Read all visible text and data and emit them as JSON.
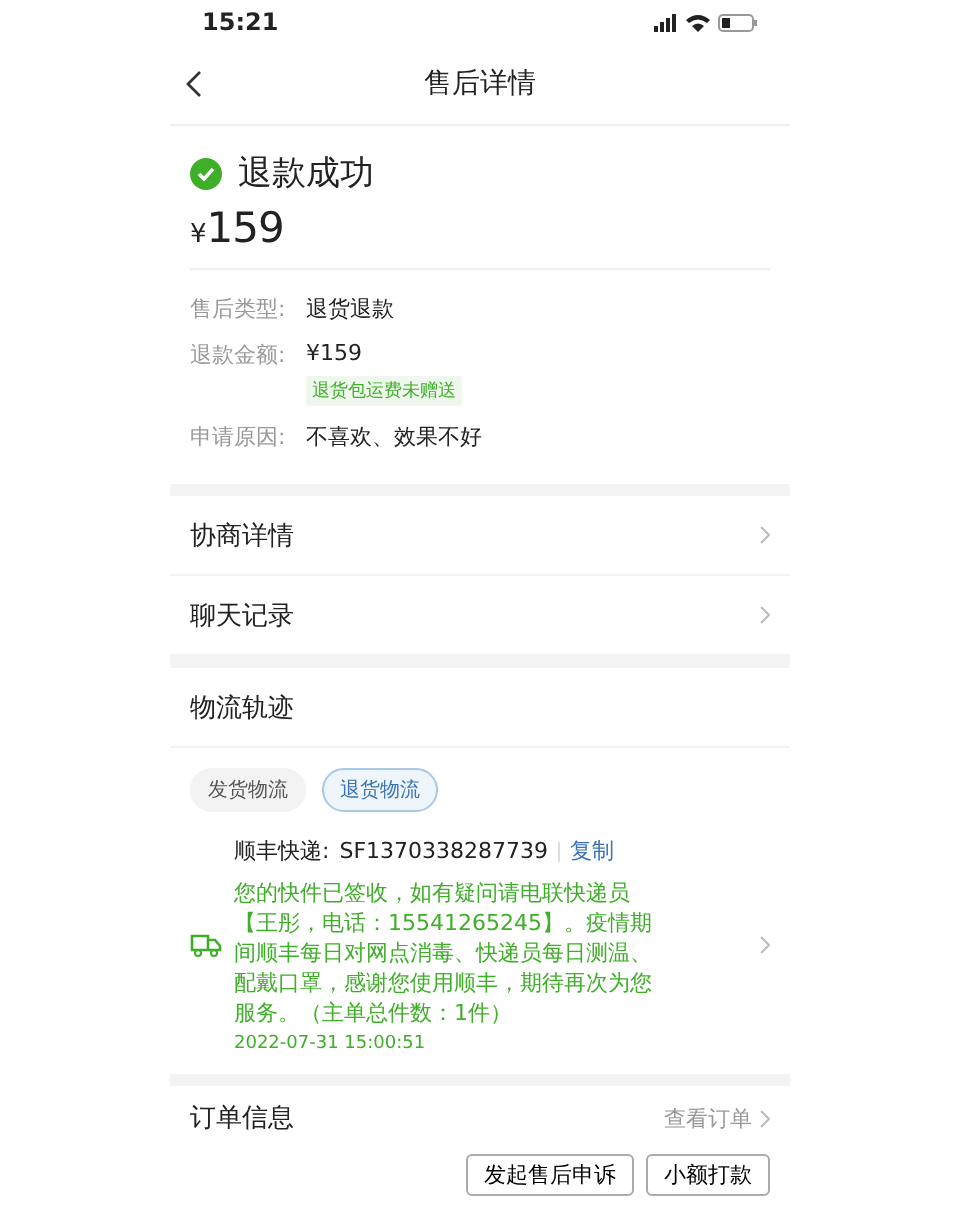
{
  "status_bar": {
    "time": "15:21"
  },
  "nav": {
    "title": "售后详情"
  },
  "refund": {
    "status": "退款成功",
    "currency": "¥",
    "amount": "159",
    "details": [
      {
        "label": "售后类型:",
        "value": "退货退款"
      },
      {
        "label": "退款金额:",
        "value": "¥159",
        "note": "退货包运费未赠送"
      },
      {
        "label": "申请原因:",
        "value": "不喜欢、效果不好"
      }
    ]
  },
  "menu_items": [
    {
      "label": "协商详情"
    },
    {
      "label": "聊天记录"
    }
  ],
  "logistics": {
    "title": "物流轨迹",
    "tabs": [
      {
        "label": "发货物流",
        "selected": false
      },
      {
        "label": "退货物流",
        "selected": true
      }
    ],
    "carrier": "顺丰快递:",
    "tracking_number": "SF1370338287739",
    "copy": "复制",
    "message": "您的快件已签收，如有疑问请电联快递员【王彤，电话：15541265245】。疫情期间顺丰每日对网点消毒、快递员每日测温、配戴口罩，感谢您使用顺丰，期待再次为您服务。（主单总件数：1件）",
    "time": "2022-07-31 15:00:51"
  },
  "order": {
    "title": "订单信息",
    "link": "查看订单"
  },
  "buttons": [
    "发起售后申诉",
    "小额打款"
  ]
}
